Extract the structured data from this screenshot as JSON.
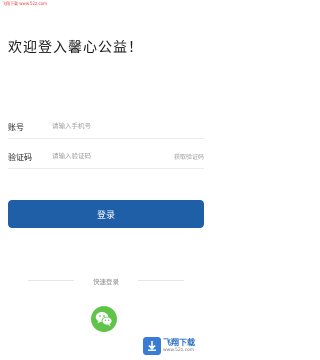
{
  "watermark_top": "飞翔下载 www.52z.com",
  "title": "欢迎登入馨心公益！",
  "account": {
    "label": "账号",
    "placeholder": "请输入手机号"
  },
  "code": {
    "label": "验证码",
    "placeholder": "请输入验证码",
    "get_code": "获取验证码"
  },
  "login_button": "登录",
  "quick_login": "快速登录",
  "wechat_icon": "wechat-icon",
  "watermark_corner": {
    "title": "飞翔下载",
    "url": "www.52z.com"
  },
  "colors": {
    "primary_button": "#1f5fa8",
    "wechat_green": "#62c34b"
  }
}
